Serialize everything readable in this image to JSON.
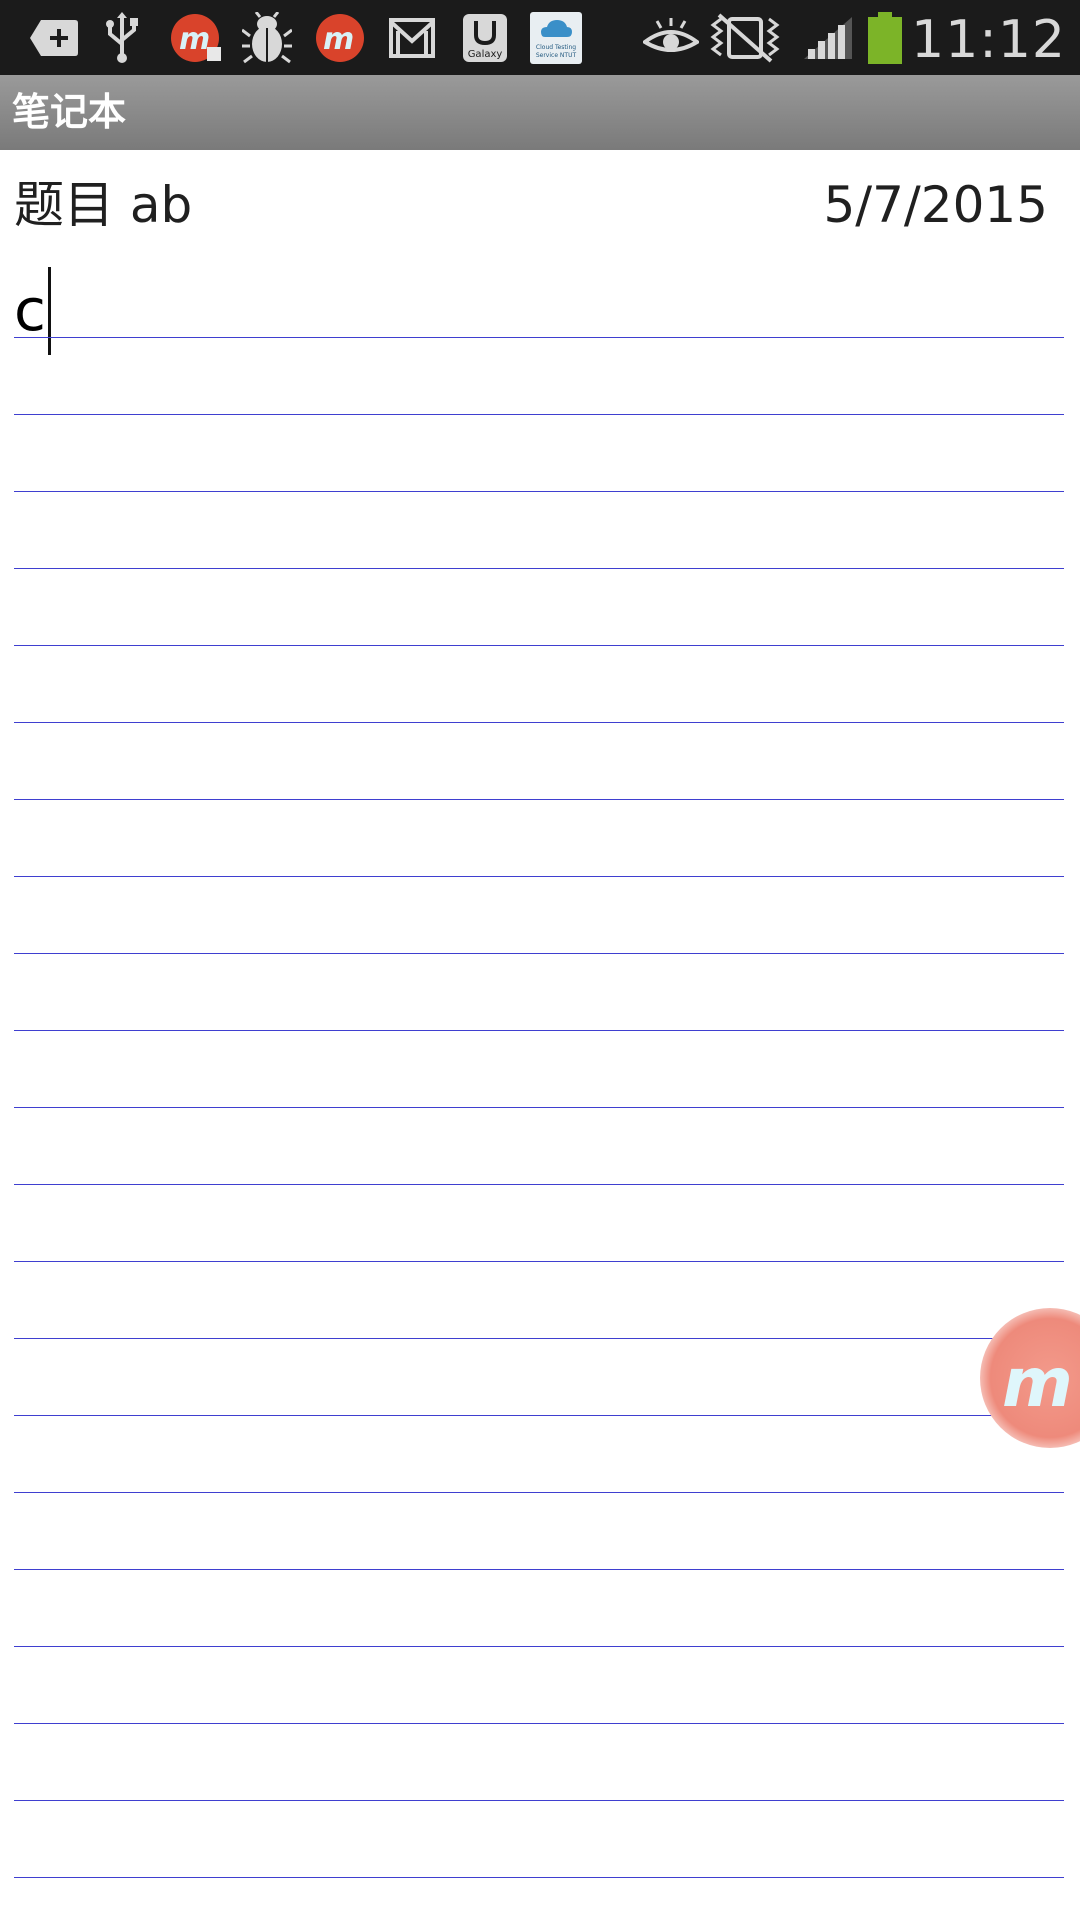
{
  "status_bar": {
    "time": "11:12",
    "icons": [
      "add-box-icon",
      "usb-icon",
      "mobizen-record-icon",
      "bug-icon",
      "mobizen-icon",
      "gmail-icon",
      "galaxy-apps-icon",
      "cloud-testing-icon",
      "eye-icon",
      "vibrate-mute-icon",
      "signal-icon",
      "battery-icon"
    ],
    "galaxy_label": "Galaxy",
    "cloud_label": "Cloud Testing Service NTUT",
    "battery_color": "#7cb428",
    "mobizen_color": "#d9432b"
  },
  "action_bar": {
    "title": "笔记本"
  },
  "note": {
    "title": "题目 ab",
    "date": "5/7/2015",
    "body_text": "c",
    "line_color": "#3f3fd0"
  },
  "floating_bubble": {
    "letter": "m",
    "color": "#ee8a7b"
  }
}
